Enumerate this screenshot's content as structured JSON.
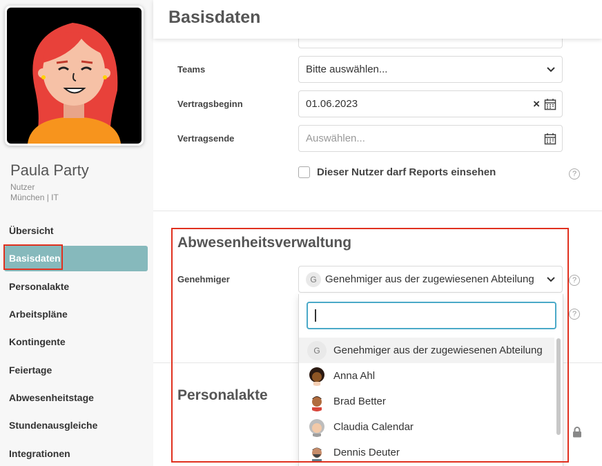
{
  "header": {
    "title": "Basisdaten"
  },
  "user": {
    "name": "Paula Party",
    "role": "Nutzer",
    "location": "München | IT"
  },
  "sidebar": {
    "items": [
      {
        "label": "Übersicht"
      },
      {
        "label": "Basisdaten",
        "active": true
      },
      {
        "label": "Personalakte"
      },
      {
        "label": "Arbeitspläne"
      },
      {
        "label": "Kontingente"
      },
      {
        "label": "Feiertage"
      },
      {
        "label": "Abwesenheitstage"
      },
      {
        "label": "Stundenausgleiche"
      },
      {
        "label": "Integrationen"
      }
    ]
  },
  "form": {
    "teams": {
      "label": "Teams",
      "value": "Bitte auswählen..."
    },
    "contract_start": {
      "label": "Vertragsbeginn",
      "value": "01.06.2023"
    },
    "contract_end": {
      "label": "Vertragsende",
      "placeholder": "Auswählen..."
    },
    "reports_checkbox": {
      "label": "Dieser Nutzer darf Reports einsehen",
      "checked": false
    }
  },
  "absence": {
    "title": "Abwesenheitsverwaltung",
    "approver": {
      "label": "Genehmiger",
      "badge": "G",
      "value": "Genehmiger aus der zugewiesenen Abteilung"
    },
    "dropdown": {
      "search_value": "",
      "options": [
        {
          "badge": "G",
          "label": "Genehmiger aus der zugewiesenen Abteilung",
          "selected": true
        },
        {
          "label": "Anna Ahl",
          "avatar": "anna-avatar"
        },
        {
          "label": "Brad Better",
          "avatar": "brad-avatar"
        },
        {
          "label": "Claudia Calendar",
          "avatar": "claudia-avatar"
        },
        {
          "label": "Dennis Deuter",
          "avatar": "dennis-avatar"
        }
      ]
    }
  },
  "personalakte": {
    "title": "Personalakte"
  },
  "icons": {
    "help": "?",
    "clear": "×",
    "help_icon": "help-circle-icon",
    "calendar_icon": "calendar-icon",
    "chevron_icon": "chevron-down-icon",
    "lock_icon": "lock-icon"
  },
  "colors": {
    "accent": "#86b9bc",
    "highlight": "#e0301e",
    "focus": "#4aa9c8"
  }
}
